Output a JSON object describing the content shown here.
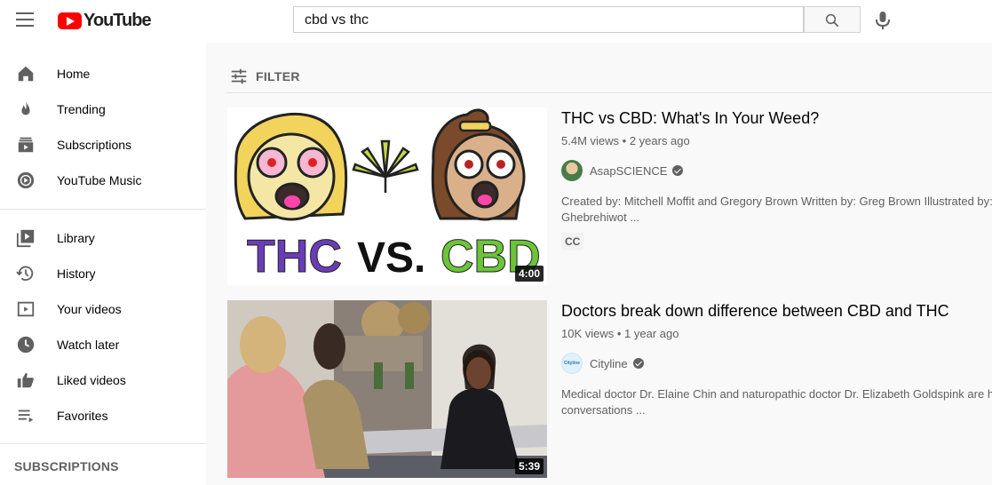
{
  "header": {
    "logo_text": "YouTube",
    "search_value": "cbd vs thc"
  },
  "sidebar": {
    "items": [
      {
        "label": "Home",
        "icon": "home-icon"
      },
      {
        "label": "Trending",
        "icon": "fire-icon"
      },
      {
        "label": "Subscriptions",
        "icon": "subscriptions-icon"
      },
      {
        "label": "YouTube Music",
        "icon": "youtube-music-icon"
      },
      {
        "label": "Library",
        "icon": "library-icon"
      },
      {
        "label": "History",
        "icon": "history-icon"
      },
      {
        "label": "Your videos",
        "icon": "your-videos-icon"
      },
      {
        "label": "Watch later",
        "icon": "clock-icon"
      },
      {
        "label": "Liked videos",
        "icon": "thumbs-up-icon"
      },
      {
        "label": "Favorites",
        "icon": "playlist-icon"
      }
    ],
    "subscriptions_title": "SUBSCRIPTIONS"
  },
  "filter": {
    "label": "FILTER"
  },
  "videos": [
    {
      "title": "THC vs CBD: What's In Your Weed?",
      "views": "5.4M views",
      "age": "2 years ago",
      "channel": "AsapSCIENCE",
      "description_1": "Created by: Mitchell Moffit and Gregory Brown Written by: Greg Brown Illustrated by: N",
      "description_2": "Ghebrehiwot ...",
      "badge": "CC",
      "duration": "4:00",
      "thumb_text_left": "THC",
      "thumb_text_mid": "VS.",
      "thumb_text_right": "CBD"
    },
    {
      "title": "Doctors break down difference between CBD and THC",
      "views": "10K views",
      "age": "1 year ago",
      "channel": "Cityline",
      "description_1": "Medical doctor Dr. Elaine Chin and naturopathic doctor Dr. Elizabeth Goldspink are here",
      "description_2": "conversations ...",
      "duration": "5:39",
      "avatar_text": "Cityline"
    }
  ],
  "colors": {
    "brand_red": "#ff0000",
    "accent_green": "#6cc43a",
    "accent_purple": "#6a3db8"
  }
}
